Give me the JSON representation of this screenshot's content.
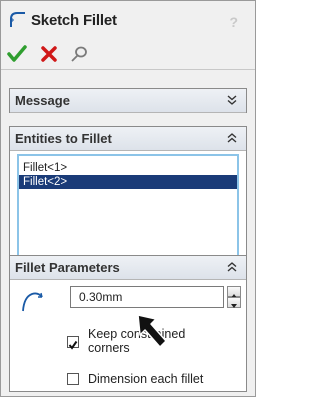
{
  "header": {
    "title": "Sketch Fillet",
    "help": "?"
  },
  "sections": {
    "message": {
      "title": "Message"
    },
    "entities": {
      "title": "Entities to Fillet",
      "items": [
        "Fillet<1>",
        "Fillet<2>"
      ],
      "selected_index": 1
    },
    "params": {
      "title": "Fillet Parameters",
      "radius_value": "0.30mm",
      "keep_constrained_label_1": "Keep constrained",
      "keep_constrained_label_2": "corners",
      "keep_constrained_checked": true,
      "dimension_each_label": "Dimension each fillet",
      "dimension_each_checked": false
    }
  },
  "icons": {
    "ok": "green-check-icon",
    "cancel": "red-x-icon",
    "pushpin": "pushpin-icon"
  },
  "colors": {
    "ok": "#2f9e2f",
    "cancel": "#d01818",
    "selection": "#1a3b78",
    "listbox_border": "#8cc4e8"
  }
}
